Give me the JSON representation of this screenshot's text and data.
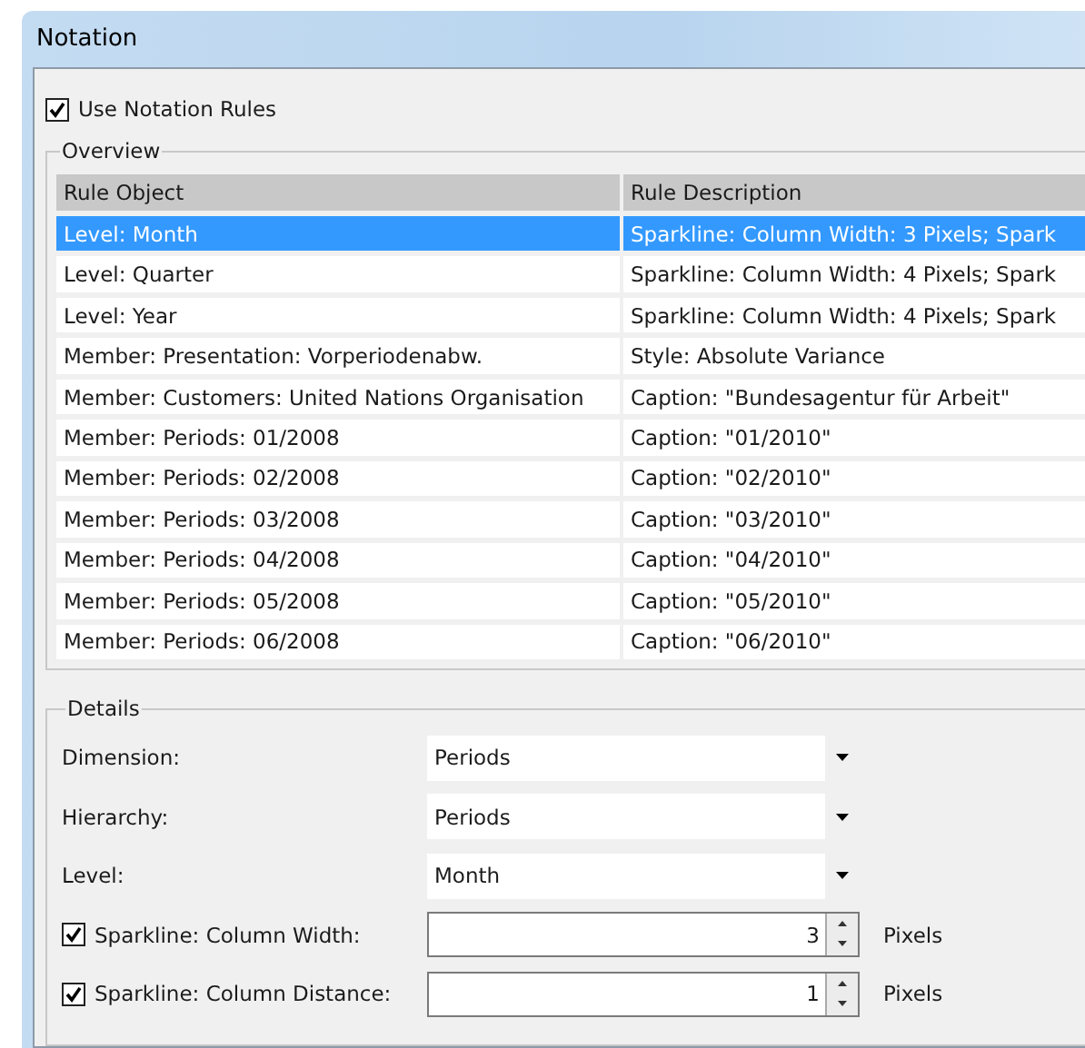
{
  "window": {
    "title": "Notation"
  },
  "use_rules": {
    "label": "Use Notation Rules",
    "checked": true
  },
  "overview": {
    "legend": "Overview",
    "columns": [
      "Rule Object",
      "Rule Description"
    ],
    "rows": [
      {
        "object": "Level: Month",
        "description": "Sparkline: Column Width: 3 Pixels; Spark",
        "selected": true
      },
      {
        "object": "Level: Quarter",
        "description": "Sparkline: Column Width: 4 Pixels; Spark",
        "selected": false
      },
      {
        "object": "Level: Year",
        "description": "Sparkline: Column Width: 4 Pixels; Spark",
        "selected": false
      },
      {
        "object": "Member: Presentation: Vorperiodenabw.",
        "description": "Style: Absolute Variance",
        "selected": false
      },
      {
        "object": "Member: Customers: United Nations Organisation",
        "description": "Caption: \"Bundesagentur für Arbeit\"",
        "selected": false
      },
      {
        "object": "Member: Periods: 01/2008",
        "description": "Caption: \"01/2010\"",
        "selected": false
      },
      {
        "object": "Member: Periods: 02/2008",
        "description": "Caption: \"02/2010\"",
        "selected": false
      },
      {
        "object": "Member: Periods: 03/2008",
        "description": "Caption: \"03/2010\"",
        "selected": false
      },
      {
        "object": "Member: Periods: 04/2008",
        "description": "Caption: \"04/2010\"",
        "selected": false
      },
      {
        "object": "Member: Periods: 05/2008",
        "description": "Caption: \"05/2010\"",
        "selected": false
      },
      {
        "object": "Member: Periods: 06/2008",
        "description": "Caption: \"06/2010\"",
        "selected": false
      }
    ]
  },
  "details": {
    "legend": "Details",
    "fields": [
      {
        "kind": "combo",
        "label": "Dimension:",
        "value": "Periods"
      },
      {
        "kind": "combo",
        "label": "Hierarchy:",
        "value": "Periods"
      },
      {
        "kind": "combo",
        "label": "Level:",
        "value": "Month"
      },
      {
        "kind": "spin",
        "label": "Sparkline: Column Width:",
        "value": "3",
        "unit": "Pixels",
        "checked": true
      },
      {
        "kind": "spin",
        "label": "Sparkline: Column Distance:",
        "value": "1",
        "unit": "Pixels",
        "checked": true
      }
    ]
  }
}
